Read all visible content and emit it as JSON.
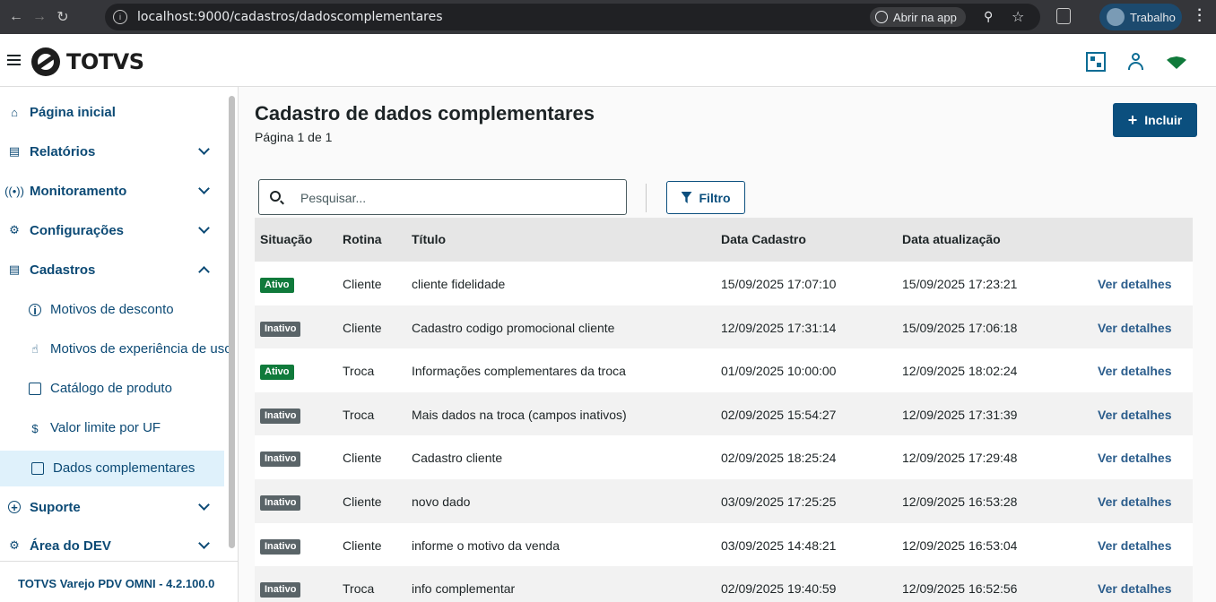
{
  "browser": {
    "url": "localhost:9000/cadastros/dadoscomplementares",
    "open_app": "Abrir na app",
    "profile": "Trabalho"
  },
  "header": {
    "brand": "TOTVS"
  },
  "sidebar": {
    "items": [
      {
        "label": "Página inicial",
        "icon": "home-icon"
      },
      {
        "label": "Relatórios",
        "icon": "list-icon"
      },
      {
        "label": "Monitoramento",
        "icon": "broadcast-icon"
      },
      {
        "label": "Configurações",
        "icon": "gear-icon"
      },
      {
        "label": "Cadastros",
        "icon": "folder-icon"
      }
    ],
    "cadastros_children": [
      {
        "label": "Motivos de desconto",
        "icon": "info-icon"
      },
      {
        "label": "Motivos de experiência de uso",
        "icon": "thumbs-up-icon"
      },
      {
        "label": "Catálogo de produto",
        "icon": "catalog-icon"
      },
      {
        "label": "Valor limite por UF",
        "icon": "dollar-icon"
      },
      {
        "label": "Dados complementares",
        "icon": "clipboard-icon"
      }
    ],
    "bottom_items": [
      {
        "label": "Suporte",
        "icon": "lifebuoy-icon"
      },
      {
        "label": "Área do DEV",
        "icon": "bug-icon"
      }
    ],
    "footer": "TOTVS Varejo PDV OMNI - 4.2.100.0"
  },
  "main": {
    "title": "Cadastro de dados complementares",
    "subtitle": "Página 1 de 1",
    "add_label": "Incluir",
    "search_placeholder": "Pesquisar...",
    "filter_label": "Filtro",
    "columns": [
      "Situação",
      "Rotina",
      "Título",
      "Data Cadastro",
      "Data atualização"
    ],
    "rows": [
      {
        "status": "Ativo",
        "active": true,
        "rotina": "Cliente",
        "titulo": "cliente fidelidade",
        "cadastro": "15/09/2025 17:07:10",
        "atualizacao": "15/09/2025 17:23:21",
        "link": "Ver detalhes"
      },
      {
        "status": "Inativo",
        "active": false,
        "rotina": "Cliente",
        "titulo": "Cadastro codigo promocional cliente",
        "cadastro": "12/09/2025 17:31:14",
        "atualizacao": "15/09/2025 17:06:18",
        "link": "Ver detalhes"
      },
      {
        "status": "Ativo",
        "active": true,
        "rotina": "Troca",
        "titulo": "Informações complementares da troca",
        "cadastro": "01/09/2025 10:00:00",
        "atualizacao": "12/09/2025 18:02:24",
        "link": "Ver detalhes"
      },
      {
        "status": "Inativo",
        "active": false,
        "rotina": "Troca",
        "titulo": "Mais dados na troca (campos inativos)",
        "cadastro": "02/09/2025 15:54:27",
        "atualizacao": "12/09/2025 17:31:39",
        "link": "Ver detalhes"
      },
      {
        "status": "Inativo",
        "active": false,
        "rotina": "Cliente",
        "titulo": "Cadastro cliente",
        "cadastro": "02/09/2025 18:25:24",
        "atualizacao": "12/09/2025 17:29:48",
        "link": "Ver detalhes"
      },
      {
        "status": "Inativo",
        "active": false,
        "rotina": "Cliente",
        "titulo": "novo dado",
        "cadastro": "03/09/2025 17:25:25",
        "atualizacao": "12/09/2025 16:53:28",
        "link": "Ver detalhes"
      },
      {
        "status": "Inativo",
        "active": false,
        "rotina": "Cliente",
        "titulo": "informe o motivo da venda",
        "cadastro": "03/09/2025 14:48:21",
        "atualizacao": "12/09/2025 16:53:04",
        "link": "Ver detalhes"
      },
      {
        "status": "Inativo",
        "active": false,
        "rotina": "Troca",
        "titulo": "info complementar",
        "cadastro": "02/09/2025 19:40:59",
        "atualizacao": "12/09/2025 16:52:56",
        "link": "Ver detalhes"
      }
    ]
  },
  "colors": {
    "primary": "#0b4f7e",
    "nav_text": "#0c4a75",
    "active_badge": "#107a3b",
    "inactive_badge": "#5a6468",
    "active_nav_bg": "#dff1fb"
  }
}
